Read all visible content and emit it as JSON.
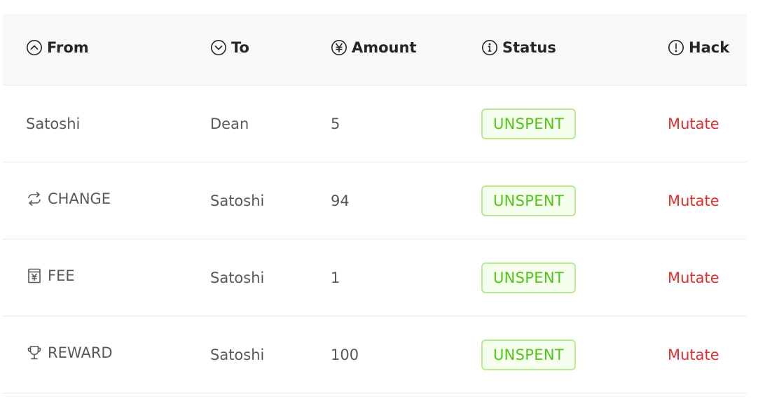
{
  "colors": {
    "header_bg": "#f8f8f8",
    "status_text": "#52c41a",
    "status_border": "#b7eb8f",
    "status_bg": "#f6ffed",
    "hack_link": "#e03030"
  },
  "columns": [
    {
      "label": "From",
      "icon": "circle-up-icon"
    },
    {
      "label": "To",
      "icon": "circle-down-icon"
    },
    {
      "label": "Amount",
      "icon": "circle-yen-icon"
    },
    {
      "label": "Status",
      "icon": "circle-info-icon"
    },
    {
      "label": "Hack",
      "icon": "circle-exclamation-icon"
    }
  ],
  "rows": [
    {
      "from": "Satoshi",
      "from_icon": "",
      "to": "Dean",
      "amount": "5",
      "status": "UNSPENT",
      "hack": "Mutate"
    },
    {
      "from": "CHANGE",
      "from_icon": "swap-icon",
      "to": "Satoshi",
      "amount": "94",
      "status": "UNSPENT",
      "hack": "Mutate"
    },
    {
      "from": "FEE",
      "from_icon": "yen-receipt-icon",
      "to": "Satoshi",
      "amount": "1",
      "status": "UNSPENT",
      "hack": "Mutate"
    },
    {
      "from": "REWARD",
      "from_icon": "trophy-icon",
      "to": "Satoshi",
      "amount": "100",
      "status": "UNSPENT",
      "hack": "Mutate"
    }
  ]
}
